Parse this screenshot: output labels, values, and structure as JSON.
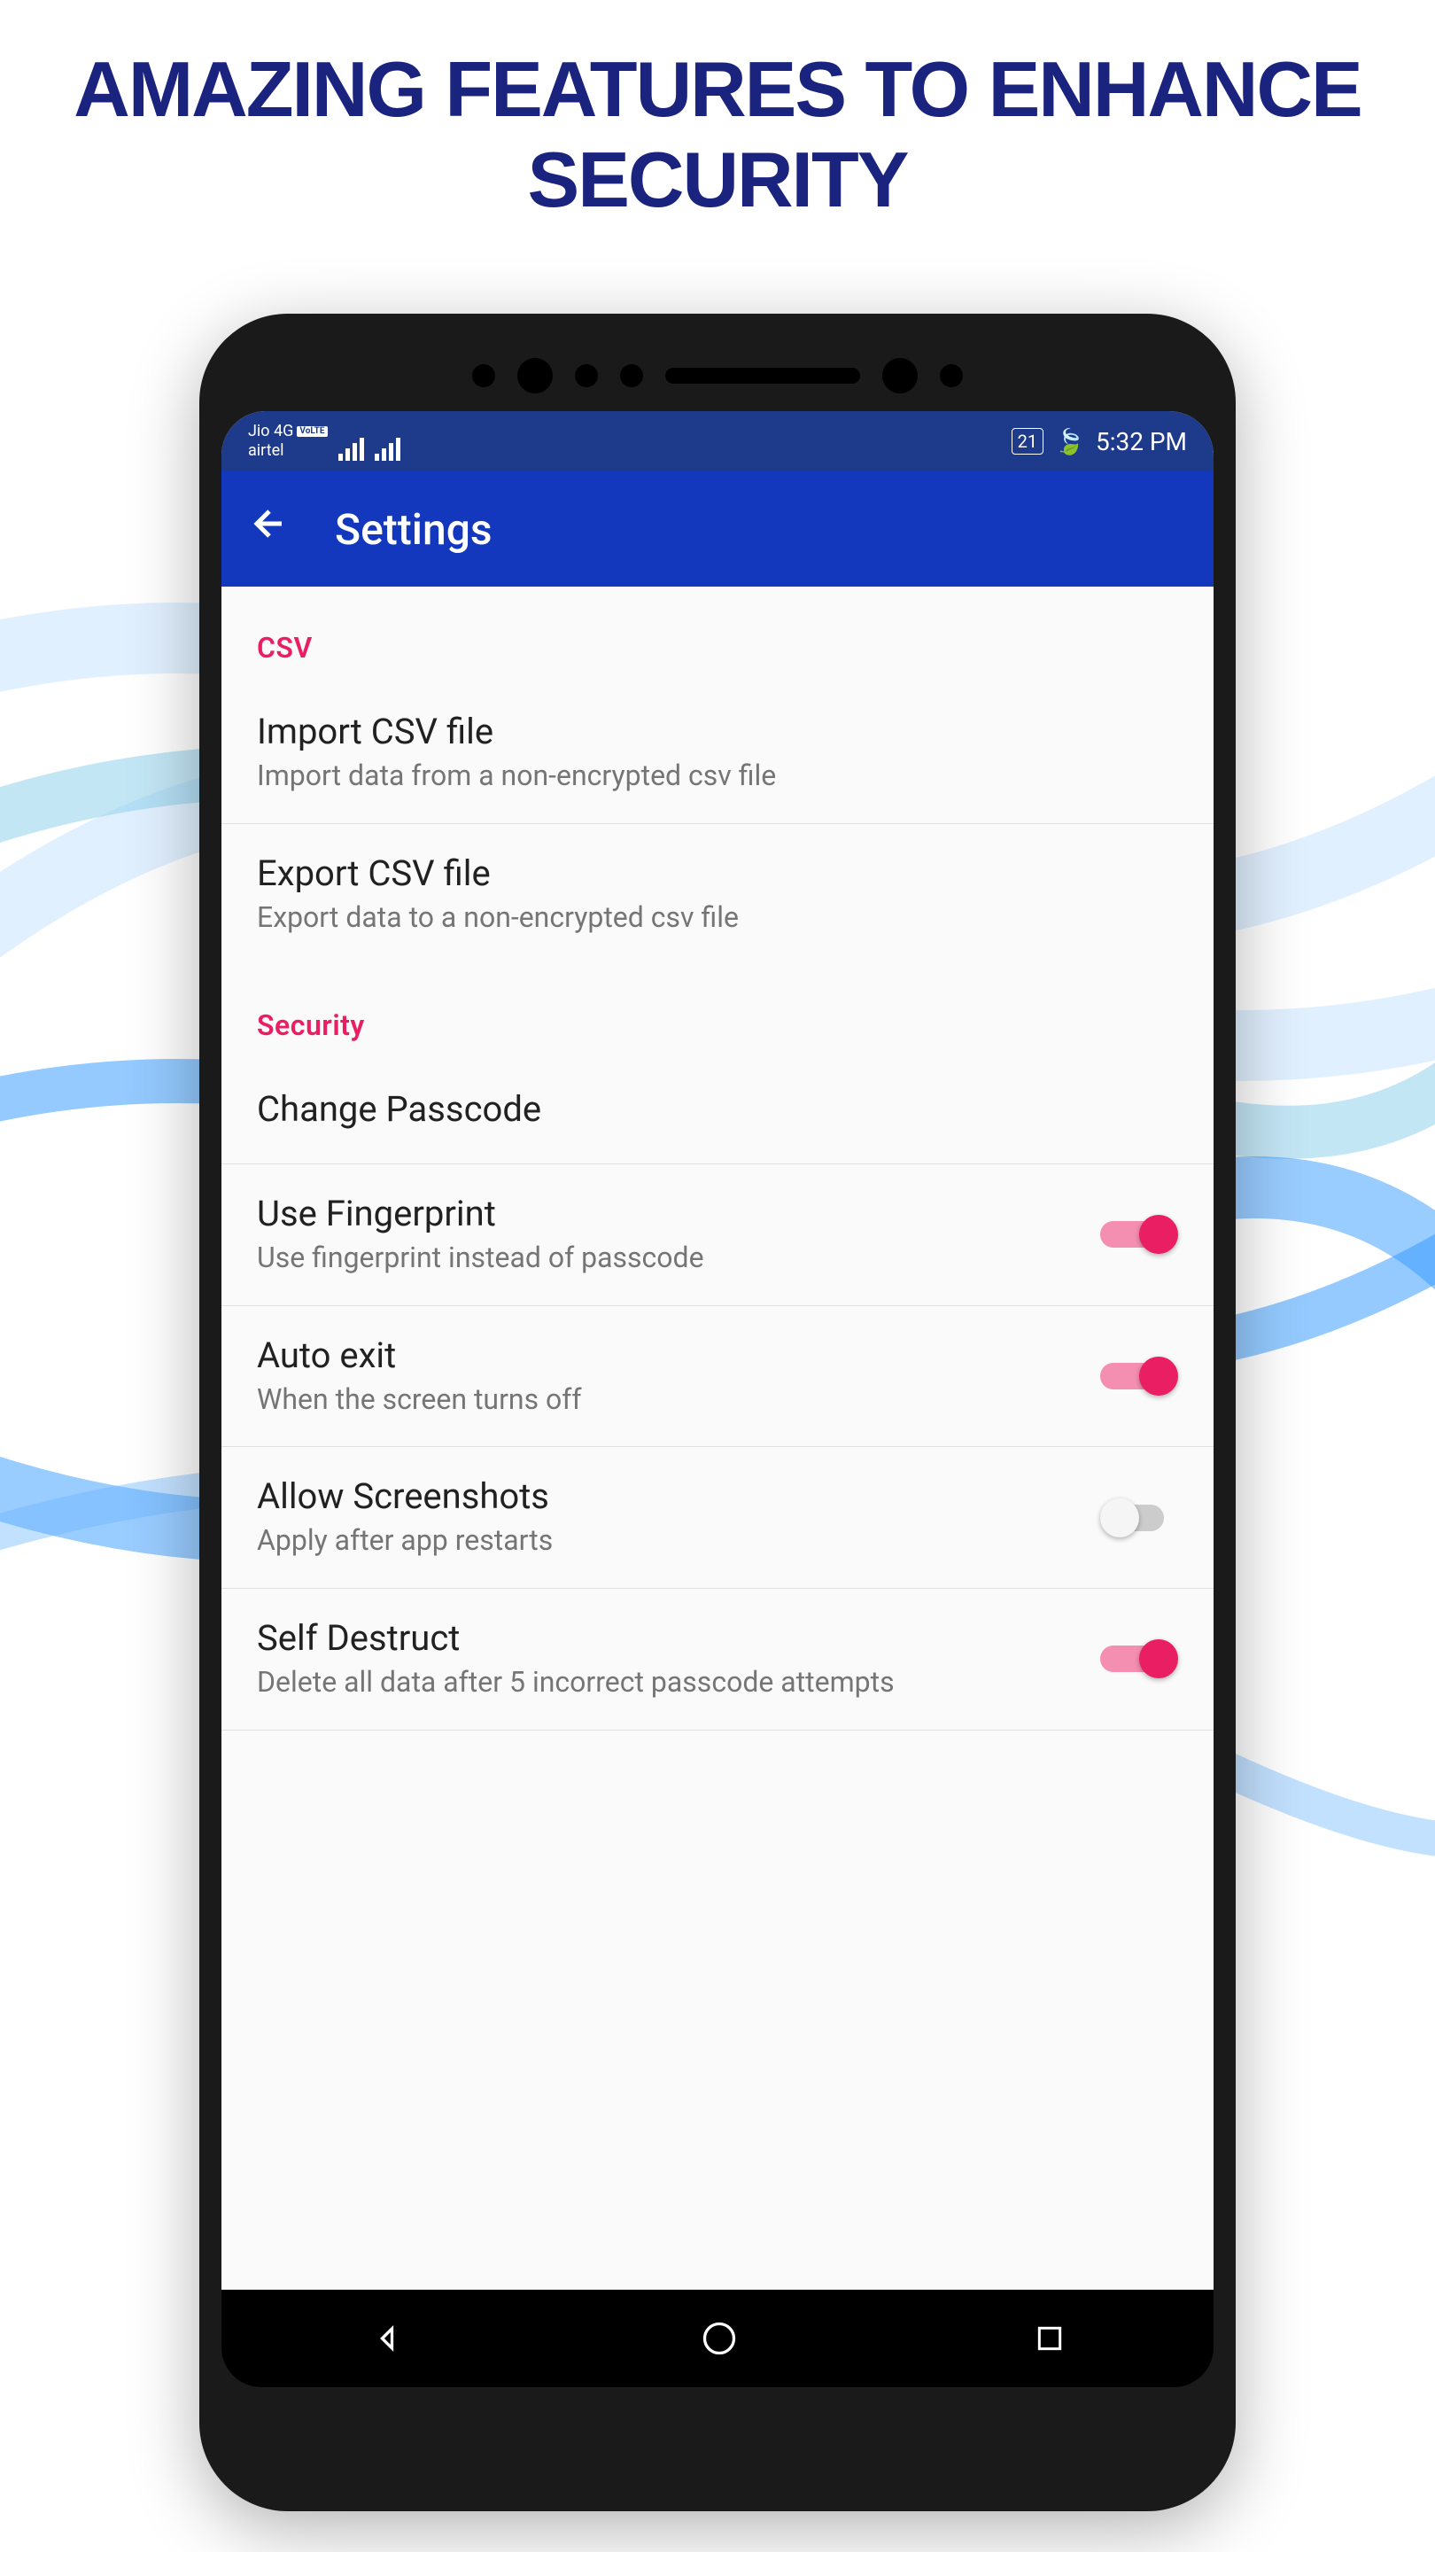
{
  "marketing": {
    "headline": "AMAZING FEATURES TO ENHANCE SECURITY"
  },
  "statusBar": {
    "carrier1": "Jio 4G",
    "volte": "VoLTE",
    "carrier2": "airtel",
    "battery": "21",
    "time": "5:32 PM"
  },
  "appBar": {
    "title": "Settings"
  },
  "sections": {
    "csv": {
      "header": "CSV",
      "items": [
        {
          "title": "Import CSV file",
          "subtitle": "Import data from a non-encrypted csv file"
        },
        {
          "title": "Export CSV file",
          "subtitle": "Export data to a non-encrypted csv file"
        }
      ]
    },
    "security": {
      "header": "Security",
      "items": [
        {
          "title": "Change Passcode",
          "subtitle": ""
        },
        {
          "title": "Use Fingerprint",
          "subtitle": "Use fingerprint instead of passcode",
          "toggle": true
        },
        {
          "title": "Auto exit",
          "subtitle": "When the screen turns off",
          "toggle": true
        },
        {
          "title": "Allow Screenshots",
          "subtitle": "Apply after app restarts",
          "toggle": false
        },
        {
          "title": "Self Destruct",
          "subtitle": "Delete all data after 5 incorrect passcode attempts",
          "toggle": true
        }
      ]
    }
  }
}
